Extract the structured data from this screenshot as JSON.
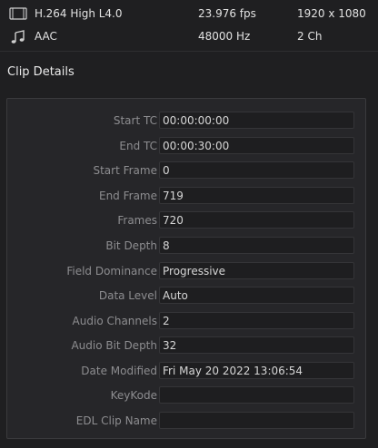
{
  "media": {
    "video": {
      "icon": "video-frame-icon",
      "codec": "H.264 High L4.0",
      "rate": "23.976 fps",
      "resolution": "1920 x 1080"
    },
    "audio": {
      "icon": "music-note-icon",
      "codec": "AAC",
      "rate": "48000 Hz",
      "channels": "2 Ch"
    }
  },
  "clip_details": {
    "title": "Clip Details",
    "fields": [
      {
        "label": "Start TC",
        "value": "00:00:00:00"
      },
      {
        "label": "End TC",
        "value": "00:00:30:00"
      },
      {
        "label": "Start Frame",
        "value": "0"
      },
      {
        "label": "End Frame",
        "value": "719"
      },
      {
        "label": "Frames",
        "value": "720"
      },
      {
        "label": "Bit Depth",
        "value": "8"
      },
      {
        "label": "Field Dominance",
        "value": "Progressive"
      },
      {
        "label": "Data Level",
        "value": "Auto"
      },
      {
        "label": "Audio Channels",
        "value": "2"
      },
      {
        "label": "Audio Bit Depth",
        "value": "32"
      },
      {
        "label": "Date Modified",
        "value": "Fri May 20 2022 13:06:54"
      },
      {
        "label": "KeyKode",
        "value": ""
      },
      {
        "label": "EDL Clip Name",
        "value": ""
      }
    ]
  }
}
